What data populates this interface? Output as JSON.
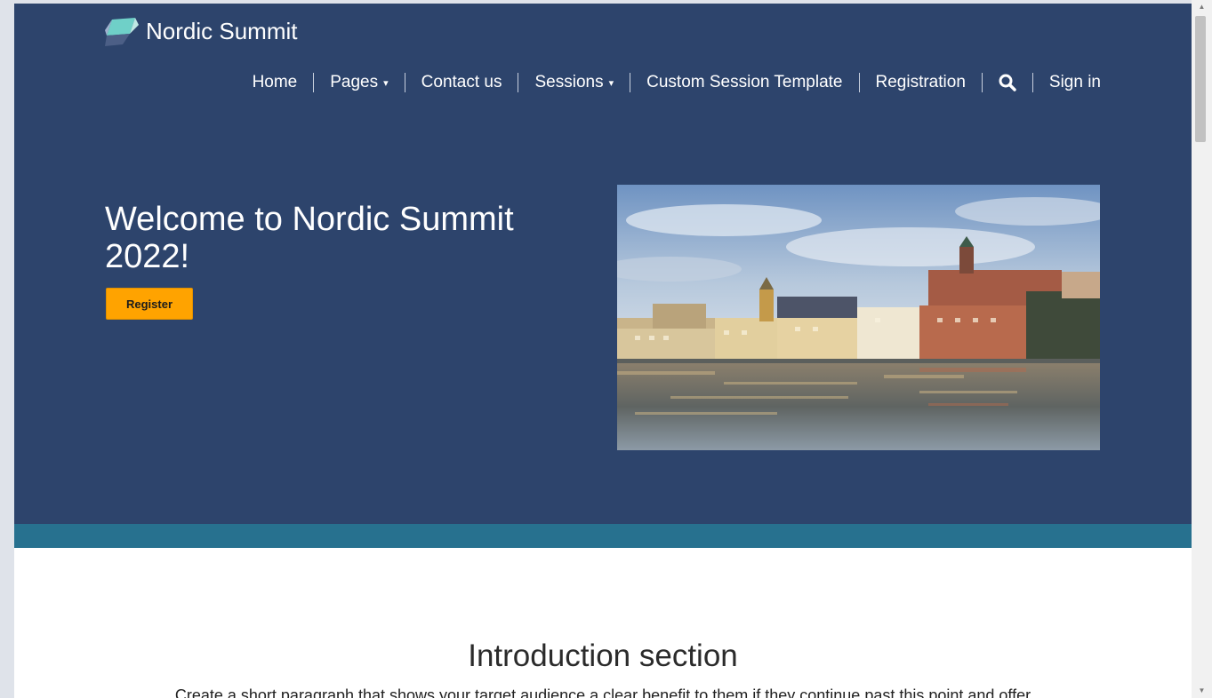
{
  "site": {
    "brand_name": "Nordic Summit",
    "logo_icon": "diamond-logo-icon"
  },
  "nav": {
    "items": [
      {
        "label": "Home"
      },
      {
        "label": "Pages",
        "caret": "▾"
      },
      {
        "label": "Contact us"
      },
      {
        "label": "Sessions",
        "caret": "▾"
      },
      {
        "label": "Custom Session Template"
      },
      {
        "label": "Registration"
      },
      {
        "label": "Sign in"
      }
    ],
    "search_icon": "search-icon"
  },
  "hero": {
    "title": "Welcome to Nordic Summit 2022!",
    "register_label": "Register",
    "image_subject": "stockholm-waterfront-image"
  },
  "intro": {
    "title": "Introduction section",
    "text": "Create a short paragraph that shows your target audience a clear benefit to them if they continue past this point and offer"
  },
  "colors": {
    "hero_bg": "#2d446c",
    "accent_band": "#27718f",
    "register_button": "#ffa300",
    "page_bg": "#ffffff"
  },
  "scrollbar": {
    "up_arrow": "▲",
    "down_arrow": "▼"
  }
}
